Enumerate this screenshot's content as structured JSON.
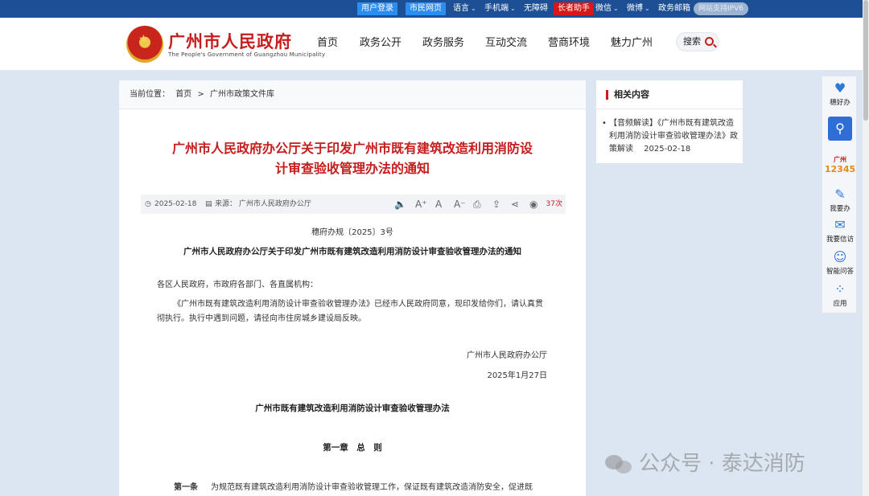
{
  "topbar": {
    "login": "用户登录",
    "citizen_page": "市民网页",
    "language": "语言",
    "mobile": "手机端",
    "accessibility": "无障碍",
    "elder_helper": "长者助手",
    "wechat": "微信",
    "weibo": "微博",
    "gov_mail": "政务邮箱",
    "ipv6": "网站支持IPV6"
  },
  "header": {
    "site_title": "广州市人民政府",
    "site_subtitle": "The People's Government of Guangzhou Municipality",
    "nav": [
      "首页",
      "政务公开",
      "政务服务",
      "互动交流",
      "营商环境",
      "魅力广州"
    ],
    "search_label": "搜索"
  },
  "breadcrumb": {
    "prefix": "当前位置：",
    "home": "首页",
    "separator": ">",
    "current": "广州市政策文件库"
  },
  "article": {
    "title": "广州市人民政府办公厅关于印发广州市既有建筑改造利用消防设计审查验收管理办法的通知",
    "date": "2025-02-18",
    "source": "来源：  广州市人民政府办公厅",
    "views": "37次",
    "doc_number": "穗府办规〔2025〕3号",
    "doc_heading": "广州市人民政府办公厅关于印发广州市既有建筑改造利用消防设计审查验收管理办法的通知",
    "addressee": "各区人民政府，市政府各部门、各直属机构：",
    "body": "《广州市既有建筑改造利用消防设计审查验收管理办法》已经市人民政府同意，现印发给你们，请认真贯彻执行。执行中遇到问题，请径向市住房城乡建设局反映。",
    "signer": "广州市人民政府办公厅",
    "sign_date": "2025年1月27日",
    "annex_title": "广州市既有建筑改造利用消防设计审查验收管理办法",
    "chapter": "第一章　总　则",
    "article1_label": "第一条",
    "article1_text": "为规范既有建筑改造利用消防设计审查验收管理工作，保证既有建筑改造消防安全，促进既"
  },
  "related": {
    "heading": "相关内容",
    "item": "【音频解读】《广州市既有建筑改造利用消防设计审查验收管理办法》政策解读　 2025-02-18"
  },
  "side": {
    "items": [
      "穗好办",
      "广州12345",
      "我要办",
      "我要信访",
      "智能问答",
      "应用"
    ],
    "brand_top": "广州",
    "brand_num": "12345"
  },
  "watermark": "公众号 · 泰达消防"
}
